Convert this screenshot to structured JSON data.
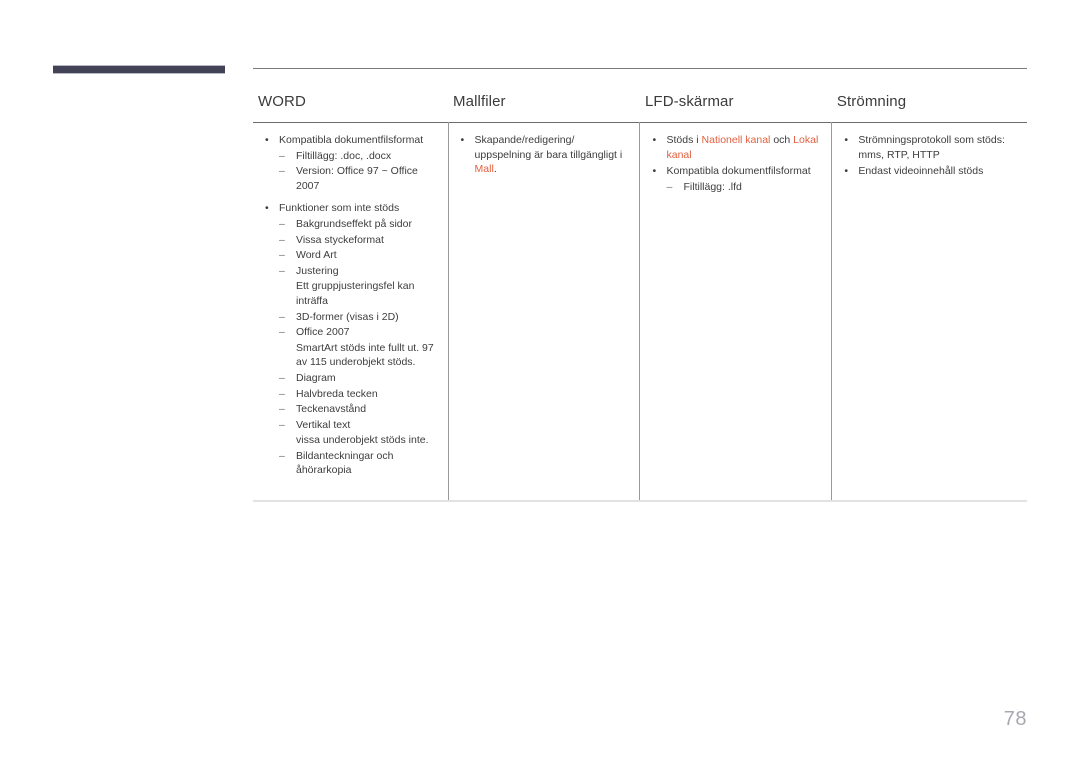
{
  "page": {
    "number": "78",
    "accent_color": "#e2603f",
    "deco_bar_color": "#434358"
  },
  "table": {
    "headers": [
      {
        "label": "WORD"
      },
      {
        "label": "Mallfiler"
      },
      {
        "label": "LFD-skärmar"
      },
      {
        "label": "Strömning"
      }
    ],
    "columns": [
      {
        "name": "word",
        "items": [
          {
            "text": "Kompatibla dokumentfilsformat",
            "sub": [
              {
                "text": "Filtillägg: .doc, .docx",
                "cont": false
              },
              {
                "text": "Version: Office 97 ~ Office 2007",
                "cont": false
              }
            ]
          },
          {
            "text": "Funktioner som inte stöds",
            "sub": [
              {
                "text": "Bakgrundseffekt på sidor",
                "cont": false
              },
              {
                "text": "Vissa styckeformat",
                "cont": false
              },
              {
                "text": "Word Art",
                "cont": false
              },
              {
                "text": "Justering",
                "cont": false
              },
              {
                "text": "Ett gruppjusteringsfel kan inträffa",
                "cont": true
              },
              {
                "text": "3D-former (visas i 2D)",
                "cont": false
              },
              {
                "text": "Office 2007",
                "cont": false
              },
              {
                "text": "SmartArt stöds inte fullt ut. 97 av 115 underobjekt stöds.",
                "cont": true
              },
              {
                "text": "Diagram",
                "cont": false
              },
              {
                "text": "Halvbreda tecken",
                "cont": false
              },
              {
                "text": "Teckenavstånd",
                "cont": false
              },
              {
                "text": "Vertikal text",
                "cont": false
              },
              {
                "text": "vissa underobjekt stöds inte.",
                "cont": true
              },
              {
                "text": "Bildanteckningar och åhörarkopia",
                "cont": false
              }
            ]
          }
        ]
      },
      {
        "name": "mallfiler",
        "items": [
          {
            "rich": [
              {
                "t": "Skapande/redigering/ uppspelning är bara tillgängligt i ",
                "accent": false
              },
              {
                "t": "Mall",
                "accent": true
              },
              {
                "t": ".",
                "accent": false
              }
            ],
            "sub": []
          }
        ]
      },
      {
        "name": "lfd-skarmar",
        "items": [
          {
            "rich": [
              {
                "t": "Stöds i ",
                "accent": false
              },
              {
                "t": "Nationell kanal",
                "accent": true
              },
              {
                "t": " och ",
                "accent": false
              },
              {
                "t": "Lokal kanal",
                "accent": true
              }
            ],
            "sub": []
          },
          {
            "text": "Kompatibla dokumentfilsformat",
            "sub": [
              {
                "text": "Filtillägg: .lfd",
                "cont": false
              }
            ]
          }
        ]
      },
      {
        "name": "stromning",
        "items": [
          {
            "text": "Strömningsprotokoll som stöds: mms, RTP, HTTP",
            "sub": []
          },
          {
            "text": "Endast videoinnehåll stöds",
            "sub": []
          }
        ]
      }
    ]
  }
}
